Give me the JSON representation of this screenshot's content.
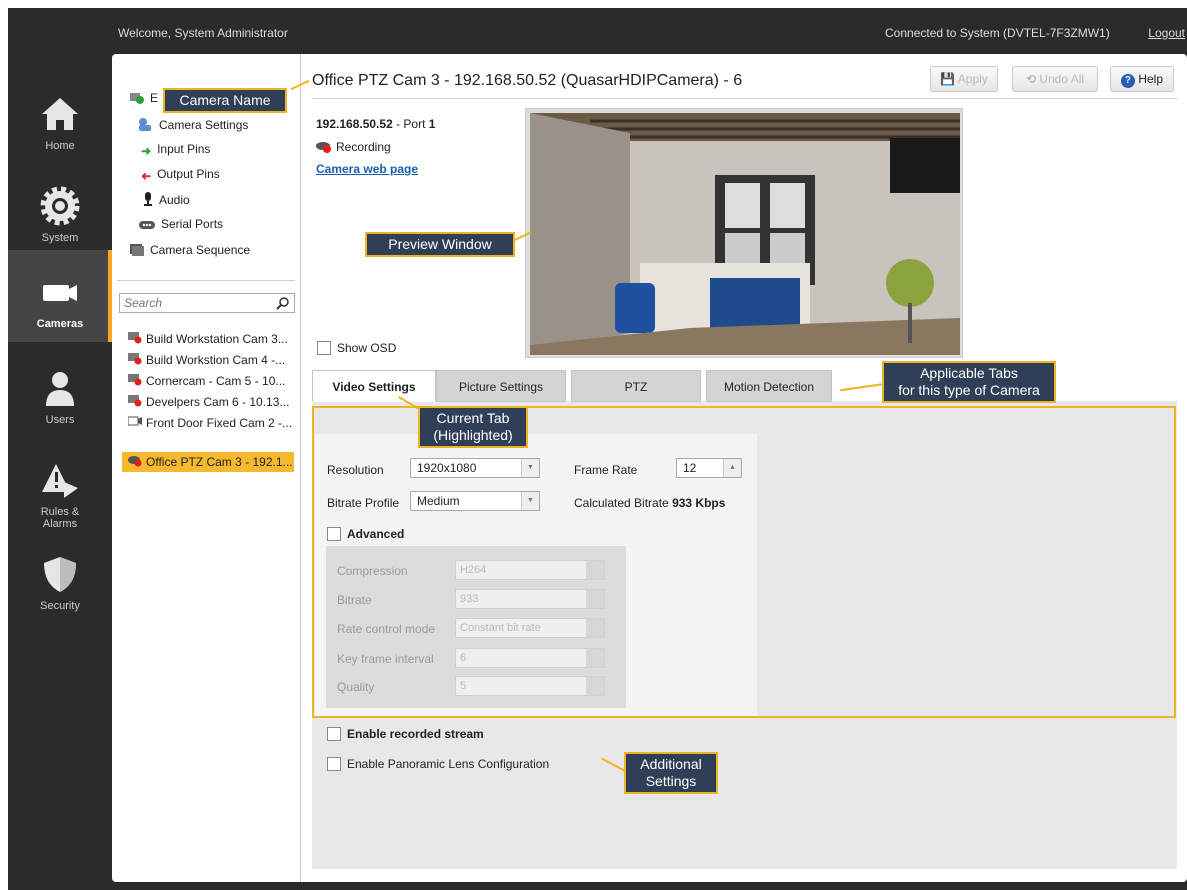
{
  "topbar": {
    "welcome": "Welcome, System Administrator",
    "connection": "Connected to System (DVTEL-7F3ZMW1)",
    "logout": "Logout"
  },
  "nav": {
    "items": [
      {
        "label": "Home",
        "icon": "home-icon"
      },
      {
        "label": "System",
        "icon": "gear-icon"
      },
      {
        "label": "Cameras",
        "icon": "camera-icon",
        "active": true
      },
      {
        "label": "Users",
        "icon": "user-icon"
      },
      {
        "label": "Rules &\nAlarms",
        "icon": "alarm-icon"
      },
      {
        "label": "Security",
        "icon": "shield-icon"
      }
    ]
  },
  "tree": {
    "root_prefix": "E",
    "items": [
      "Camera Settings",
      "Input Pins",
      "Output Pins",
      "Audio",
      "Serial Ports"
    ],
    "sequence": "Camera Sequence"
  },
  "search": {
    "placeholder": "Search"
  },
  "camera_list": [
    "Build Workstation Cam 3...",
    "Build Workstion Cam 4 -...",
    "Cornercam - Cam 5 - 10...",
    "Develpers Cam 6 - 10.13...",
    "Front Door Fixed Cam 2 -...",
    "Office PTZ Cam 3 - 192.1..."
  ],
  "header": {
    "title": "Office PTZ Cam 3 - 192.168.50.52 (QuasarHDIPCamera) - 6",
    "apply": "Apply",
    "undo_all": "Undo All",
    "help": "Help"
  },
  "camera_info": {
    "ip": "192.168.50.52",
    "port_label": "- Port",
    "port": "1",
    "recording": "Recording",
    "web_page": "Camera web page"
  },
  "show_osd": "Show OSD",
  "tabs": [
    "Video Settings",
    "Picture Settings",
    "PTZ",
    "Motion Detection"
  ],
  "video_settings": {
    "resolution_label": "Resolution",
    "resolution": "1920x1080",
    "frame_rate_label": "Frame Rate",
    "frame_rate": "12",
    "bitrate_profile_label": "Bitrate Profile",
    "bitrate_profile": "Medium",
    "calc_bitrate_label": "Calculated Bitrate",
    "calc_bitrate": "933 Kbps",
    "advanced_label": "Advanced",
    "advanced": {
      "compression_label": "Compression",
      "compression": "H264",
      "bitrate_label": "Bitrate",
      "bitrate": "933",
      "rate_control_label": "Rate control mode",
      "rate_control": "Constant bit rate",
      "key_frame_label": "Key frame interval",
      "key_frame": "6",
      "quality_label": "Quality",
      "quality": "5"
    }
  },
  "extra": {
    "enable_recorded": "Enable recorded stream",
    "enable_panoramic": "Enable Panoramic Lens Configuration"
  },
  "annotations": {
    "camera_name": "Camera Name",
    "preview_window": "Preview Window",
    "applicable_tabs_1": "Applicable Tabs",
    "applicable_tabs_2": "for this type of Camera",
    "current_tab_1": "Current Tab",
    "current_tab_2": "(Highlighted)",
    "additional_1": "Additional",
    "additional_2": "Settings"
  }
}
